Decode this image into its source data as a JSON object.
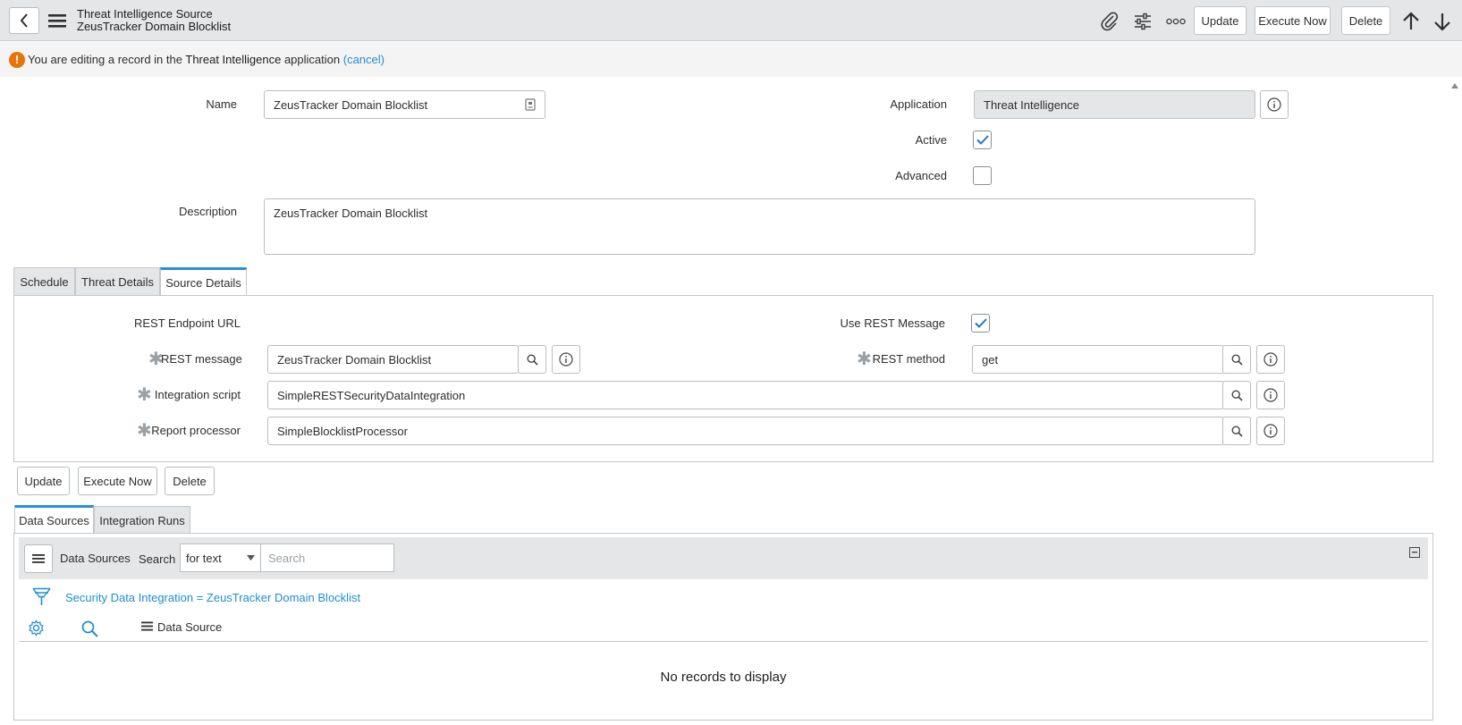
{
  "header": {
    "title_line1": "Threat Intelligence Source",
    "title_line2": "ZeusTracker Domain Blocklist",
    "buttons": {
      "update": "Update",
      "execute_now": "Execute Now",
      "delete": "Delete"
    },
    "icons": [
      "back-icon",
      "menu-icon",
      "paperclip-icon",
      "sliders-icon",
      "more-icon",
      "arrow-up-icon",
      "arrow-down-icon"
    ]
  },
  "notice": {
    "prefix": "You are editing a record in the",
    "app": "Threat Intelligence",
    "suffix": "application",
    "cancel": "(cancel)"
  },
  "form": {
    "name_label": "Name",
    "name_value": "ZeusTracker Domain Blocklist",
    "application_label": "Application",
    "application_value": "Threat Intelligence",
    "active_label": "Active",
    "active_checked": true,
    "advanced_label": "Advanced",
    "advanced_checked": false,
    "description_label": "Description",
    "description_value": "ZeusTracker Domain Blocklist"
  },
  "tabs": [
    "Schedule",
    "Threat Details",
    "Source Details"
  ],
  "active_tab": "Source Details",
  "source_details": {
    "rest_endpoint_label": "REST Endpoint URL",
    "use_rest_label": "Use REST Message",
    "use_rest_checked": true,
    "rest_message_label": "REST message",
    "rest_message_value": "ZeusTracker Domain Blocklist",
    "rest_method_label": "REST method",
    "rest_method_value": "get",
    "integration_script_label": "Integration script",
    "integration_script_value": "SimpleRESTSecurityDataIntegration",
    "report_processor_label": "Report processor",
    "report_processor_value": "SimpleBlocklistProcessor",
    "required_mark": "✱"
  },
  "form_buttons": {
    "update": "Update",
    "execute_now": "Execute Now",
    "delete": "Delete"
  },
  "related_tabs": [
    "Data Sources",
    "Integration Runs"
  ],
  "related_list": {
    "title": "Data Sources",
    "search_label": "Search",
    "search_select": "for text",
    "search_placeholder": "Search",
    "filter_text": "Security Data Integration = ZeusTracker Domain Blocklist",
    "column_header": "Data Source",
    "empty_message": "No records to display"
  },
  "colors": {
    "accent": "#2a8fd6",
    "link": "#1f8ecd",
    "warning": "#e8730c",
    "header_bg": "#e4e6e7"
  }
}
